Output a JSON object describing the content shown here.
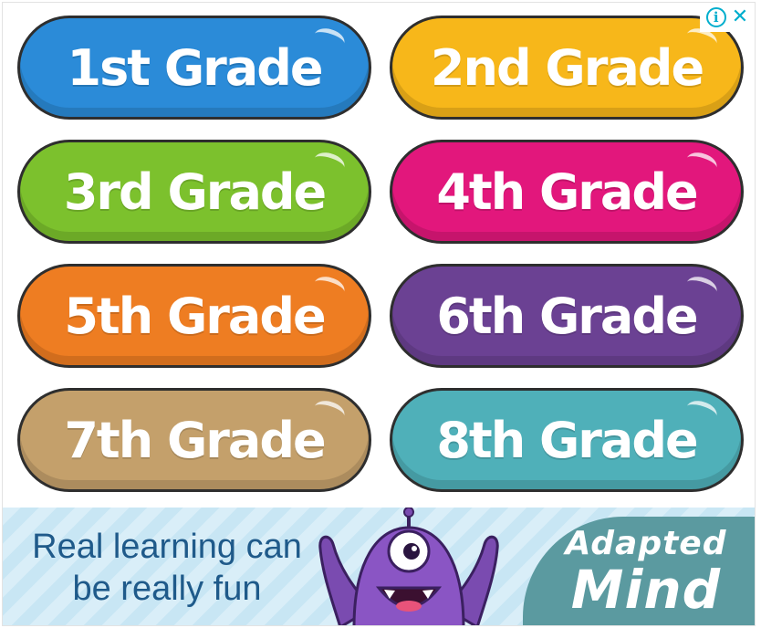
{
  "ad_choices": {
    "info_glyph": "i",
    "close_glyph": "✕"
  },
  "grades": [
    {
      "label": "1st Grade",
      "color": "#2b8bd8"
    },
    {
      "label": "2nd Grade",
      "color": "#f7b71a"
    },
    {
      "label": "3rd Grade",
      "color": "#7cc12d"
    },
    {
      "label": "4th Grade",
      "color": "#e2177c"
    },
    {
      "label": "5th Grade",
      "color": "#ee7d22"
    },
    {
      "label": "6th Grade",
      "color": "#6b4193"
    },
    {
      "label": "7th Grade",
      "color": "#c4a06b"
    },
    {
      "label": "8th Grade",
      "color": "#4fb0b9"
    }
  ],
  "banner": {
    "tagline_line1": "Real learning can",
    "tagline_line2": "be really fun",
    "brand_line1": "Adapted",
    "brand_line2": "Mind",
    "mascot_icon": "purple-monster-icon"
  }
}
